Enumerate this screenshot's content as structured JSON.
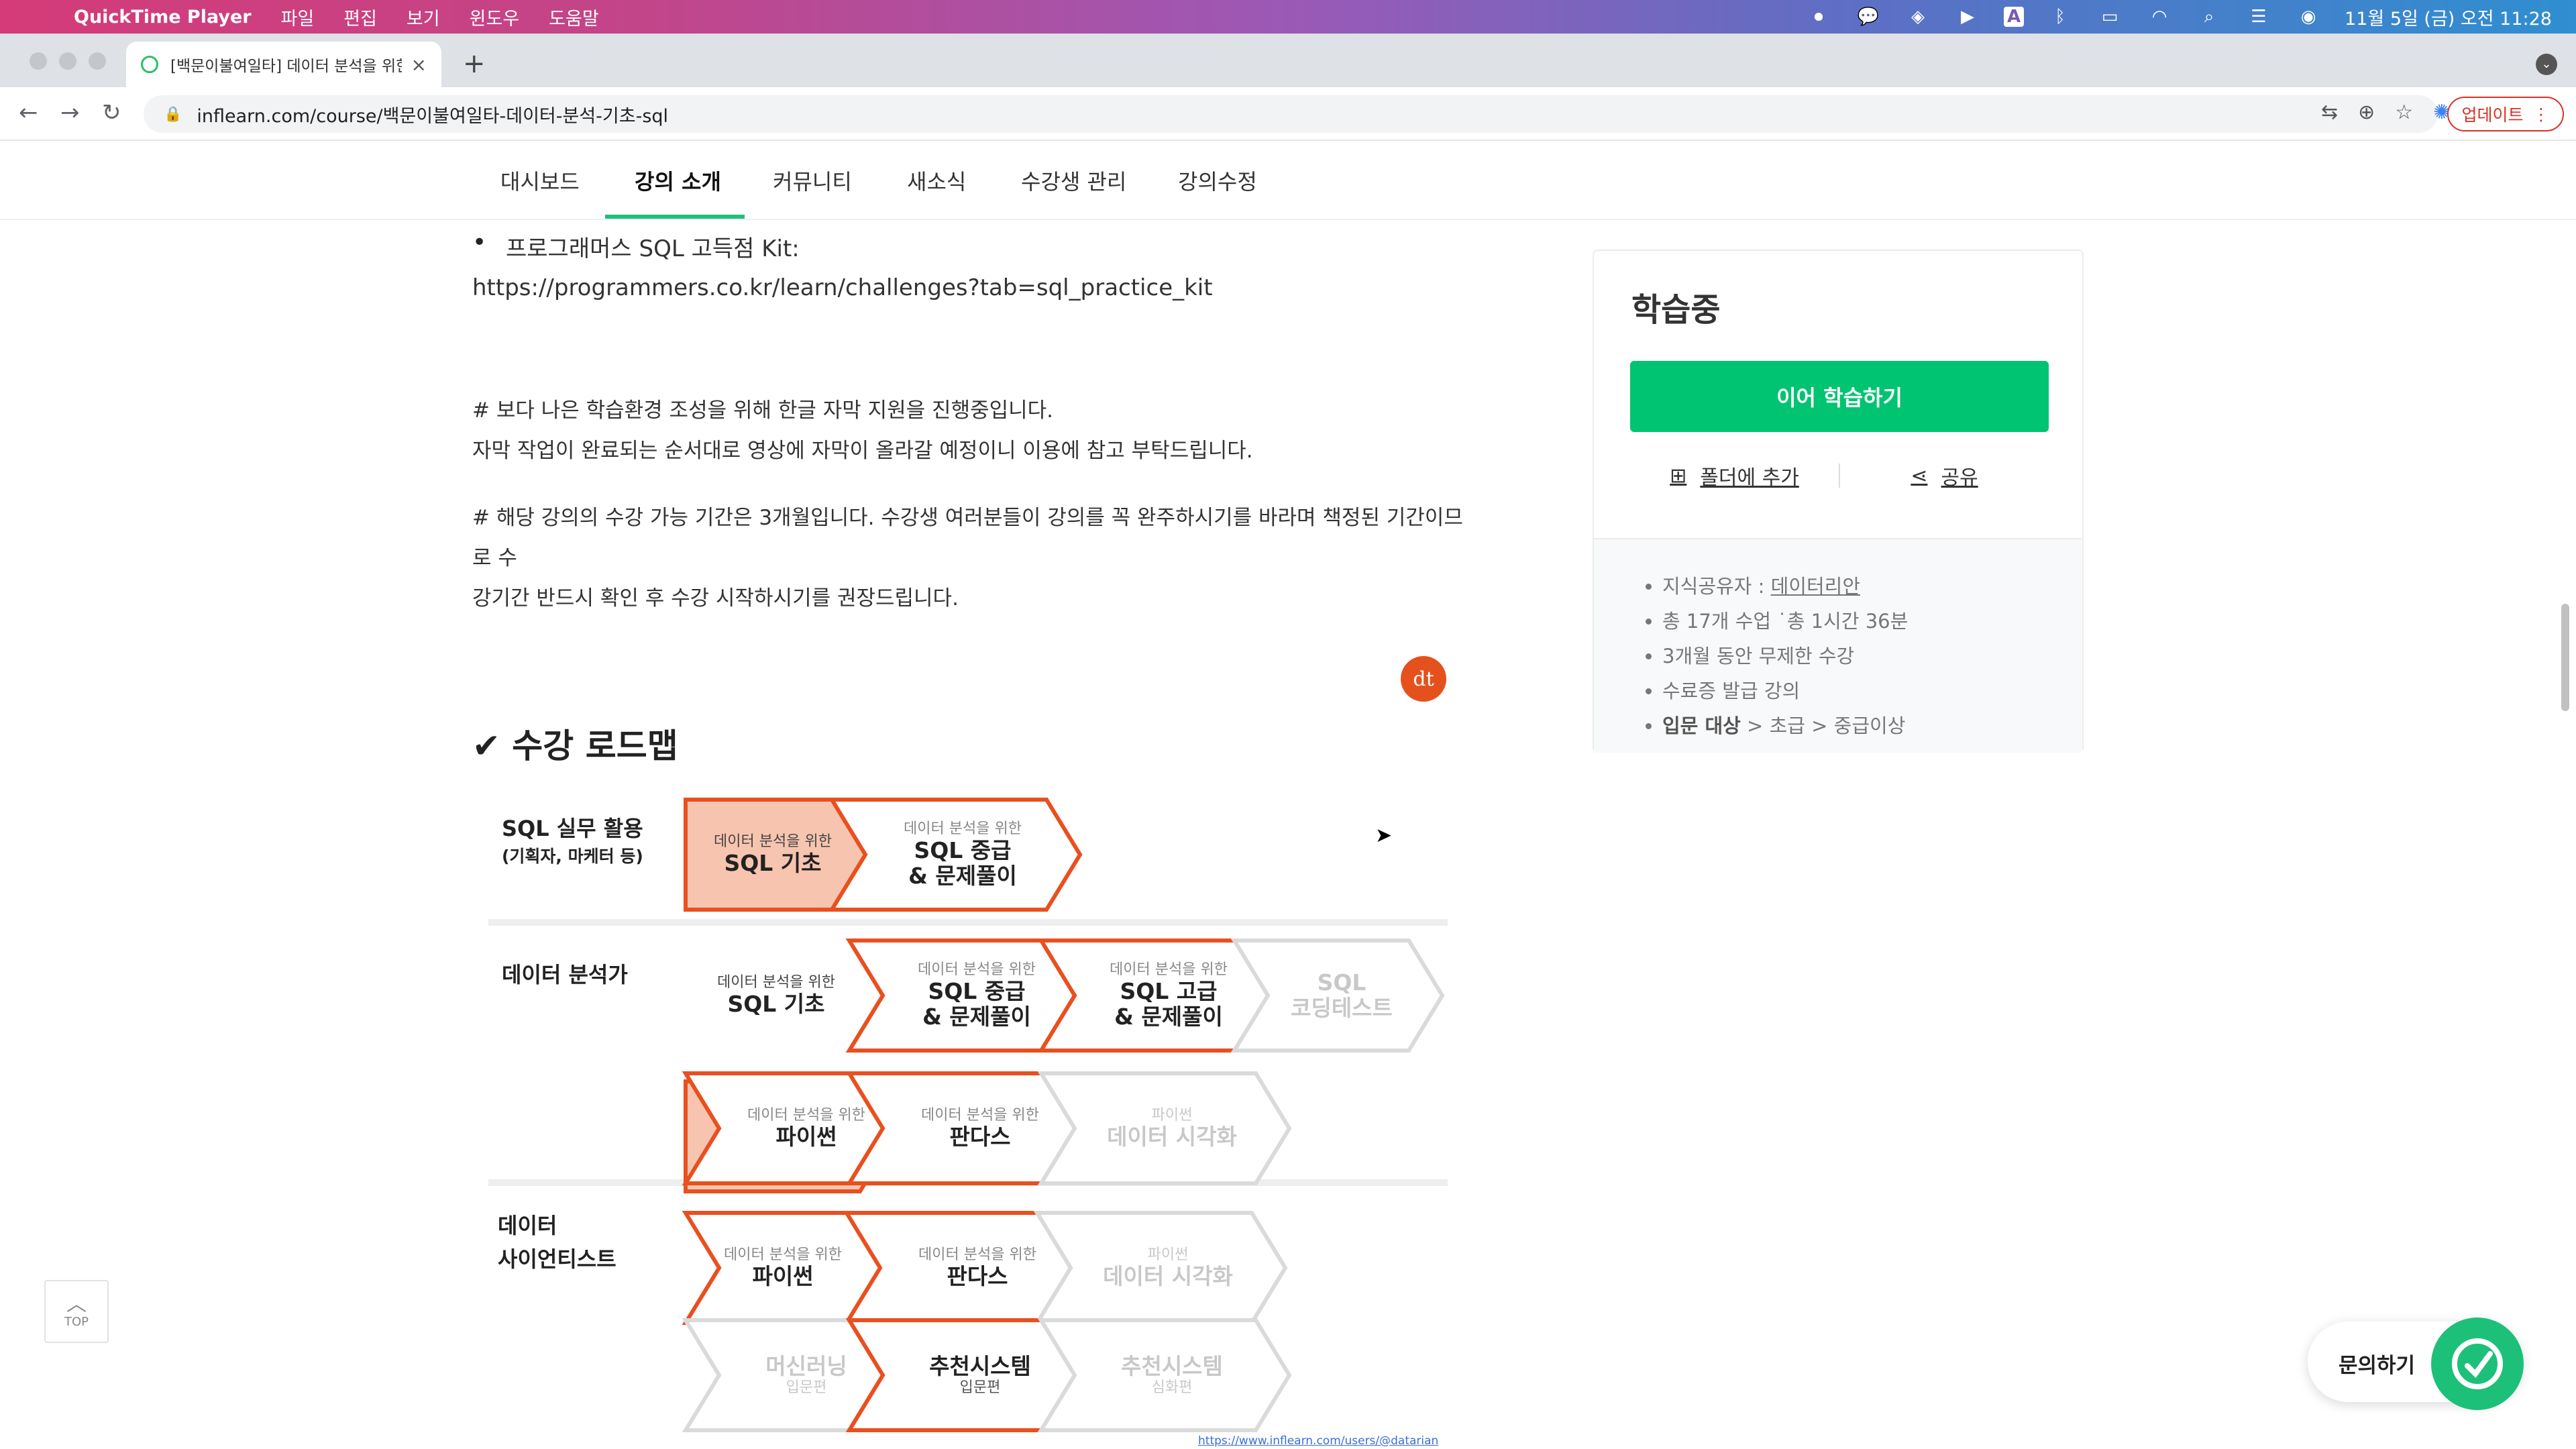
{
  "menubar": {
    "app_name": "QuickTime Player",
    "items": [
      "파일",
      "편집",
      "보기",
      "윈도우",
      "도움말"
    ],
    "clock": "11월 5일 (금) 오전 11:28",
    "input_source": "A"
  },
  "browser": {
    "tab_title": "[백문이불여일타] 데이터 분석을 위한",
    "url": "inflearn.com/course/백문이불여일타-데이터-분석-기초-sql",
    "update_label": "업데이트"
  },
  "course_nav": {
    "tabs": [
      "대시보드",
      "강의 소개",
      "커뮤니티",
      "새소식",
      "수강생 관리",
      "강의수정"
    ],
    "active": "강의 소개"
  },
  "content": {
    "kit_label": "프로그래머스 SQL 고득점 Kit:",
    "kit_url": "https://programmers.co.kr/learn/challenges?tab=sql_practice_kit",
    "note1_line1": "# 보다 나은 학습환경 조성을 위해 한글 자막 지원을 진행중입니다.",
    "note1_line2": "자막 작업이 완료되는 순서대로 영상에 자막이 올라갈 예정이니 이용에 참고 부탁드립니다.",
    "note2_line1": "# 해당 강의의 수강 가능 기간은 3개월입니다. 수강생 여러분들이 강의를 꼭 완주하시기를 바라며 책정된 기간이므로 수",
    "note2_line2": "강기간 반드시 확인 후 수강 시작하시기를 권장드립니다.",
    "roadmap_heading": "✔ 수강 로드맵"
  },
  "roadmap": {
    "row_sql": {
      "label": "SQL 실무 활용",
      "sublabel": "(기획자, 마케터 등)"
    },
    "row_analyst": {
      "label": "데이터 분석가"
    },
    "row_scientist": {
      "label_line1": "데이터",
      "label_line2": "사이언티스트"
    },
    "sub_for_analysis": "데이터 분석을 위한",
    "sub_python": "파이썬",
    "sub_intro": "입문편",
    "sub_advanced": "심화편",
    "sql_basic": "SQL 기초",
    "sql_mid_1": "SQL 중급",
    "sql_mid_2": "& 문제풀이",
    "sql_adv_1": "SQL 고급",
    "sql_adv_2": "& 문제풀이",
    "sql_coding_1": "SQL",
    "sql_coding_2": "코딩테스트",
    "python": "파이썬",
    "pandas": "판다스",
    "dataviz": "데이터 시각화",
    "ml": "머신러닝",
    "recsys": "추천시스템",
    "credit": "https://www.inflearn.com/users/@datarian",
    "avatar_initials": "dt"
  },
  "sidebar": {
    "status": "학습중",
    "continue_button": "이어 학습하기",
    "folder_button": "폴더에 추가",
    "share_button": "공유",
    "info": {
      "instructor_prefix": "지식공유자 : ",
      "instructor": "데이터리안",
      "lessons": "총 17개 수업 ˙총 1시간 36분",
      "period": "3개월 동안 무제한 수강",
      "certificate": "수료증 발급 강의",
      "level_label": "입문 대상",
      "level_rest": " > 초급 > 중급이상"
    }
  },
  "floating": {
    "top_label": "TOP",
    "inquiry_label": "문의하기"
  },
  "colors": {
    "accent_green": "#00c471",
    "roadmap_orange": "#e8501f",
    "roadmap_fill": "#f7c4b0",
    "menubar_gradient": [
      "#d43b78",
      "#9b59b6",
      "#2f8fd0"
    ]
  }
}
